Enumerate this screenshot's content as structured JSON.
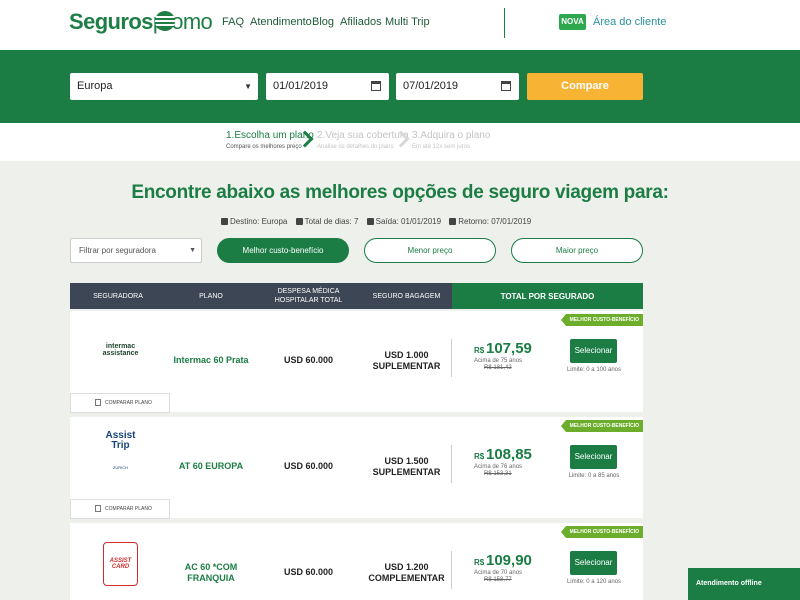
{
  "header": {
    "logo_brand": "Seguros",
    "logo_accent": "promo",
    "nav": [
      "FAQ",
      "Atendimento",
      "Blog",
      "Afiliados",
      "Multi Trip"
    ],
    "badge": "NOVA",
    "client_area": "Área do cliente"
  },
  "search": {
    "destination": "Europa",
    "date_start": "01/01/2019",
    "date_end": "07/01/2019",
    "compare_button": "Compare"
  },
  "steps": [
    {
      "title": "1.Escolha um plano",
      "sub": "Compare os melhores preço",
      "active": true
    },
    {
      "title": "2.Veja sua cobertura",
      "sub": "Analise os detalhes do plano",
      "active": false
    },
    {
      "title": "3.Adquira o plano",
      "sub": "Em até 12x sem juros",
      "active": false
    }
  ],
  "headline": "Encontre abaixo as melhores opções de seguro viagem para:",
  "trip": {
    "destination": "Destino: Europa",
    "days": "Total de dias: 7",
    "departure": "Saída: 01/01/2019",
    "return": "Retorno: 07/01/2019"
  },
  "filters": {
    "select_placeholder": "Filtrar por seguradora",
    "best_value": "Melhor custo-benefício",
    "lowest_price": "Menor preço",
    "highest_price": "Maior preço"
  },
  "table": {
    "headers": [
      "SEGURADORA",
      "PLANO",
      "DESPESA MÉDICA HOSPITALAR TOTAL",
      "SEGURO BAGAGEM",
      "TOTAL POR SEGURADO"
    ],
    "rows": [
      {
        "tag": "MELHOR CUSTO-BENEFÍCIO",
        "logo_line1": "intermac",
        "logo_line2": "assistance",
        "plan": "Intermac 60 Prata",
        "medical": "USD 60.000",
        "baggage": "USD 1.000 SUPLEMENTAR",
        "currency": "R$",
        "price": "107,59",
        "age_note": "Acima de 75 anos",
        "old_price": "R$ 181,42",
        "select": "Selecionar",
        "limit": "Limite: 0 a 100 anos",
        "compare": "COMPARAR PLANO"
      },
      {
        "tag": "MELHOR CUSTO-BENEFÍCIO",
        "logo_line1": "Assist",
        "logo_line2": "Trip",
        "logo_sub": "ZURICH",
        "plan": "AT 60 EUROPA",
        "medical": "USD 60.000",
        "baggage": "USD 1.500 SUPLEMENTAR",
        "currency": "R$",
        "price": "108,85",
        "age_note": "Acima de 76 anos",
        "old_price": "R$ 153,31",
        "select": "Selecionar",
        "limit": "Limite: 0 a 85 anos",
        "compare": "COMPARAR PLANO"
      },
      {
        "tag": "MELHOR CUSTO-BENEFÍCIO",
        "logo_line1": "ASSIST CARD",
        "plan": "AC 60 *COM FRANQUIA",
        "medical": "USD 60.000",
        "baggage": "USD 1.200 COMPLEMENTAR",
        "currency": "R$",
        "price": "109,90",
        "age_note": "Acima de 70 anos",
        "old_price": "R$ 158,77",
        "select": "Selecionar",
        "limit": "Limite: 0 a 120 anos"
      }
    ]
  },
  "chat": "Atendimento offline",
  "colors": {
    "brand_green": "#1b7d44",
    "accent_orange": "#f7b334",
    "tag_green": "#6cae2b",
    "table_header": "#3c4654"
  }
}
